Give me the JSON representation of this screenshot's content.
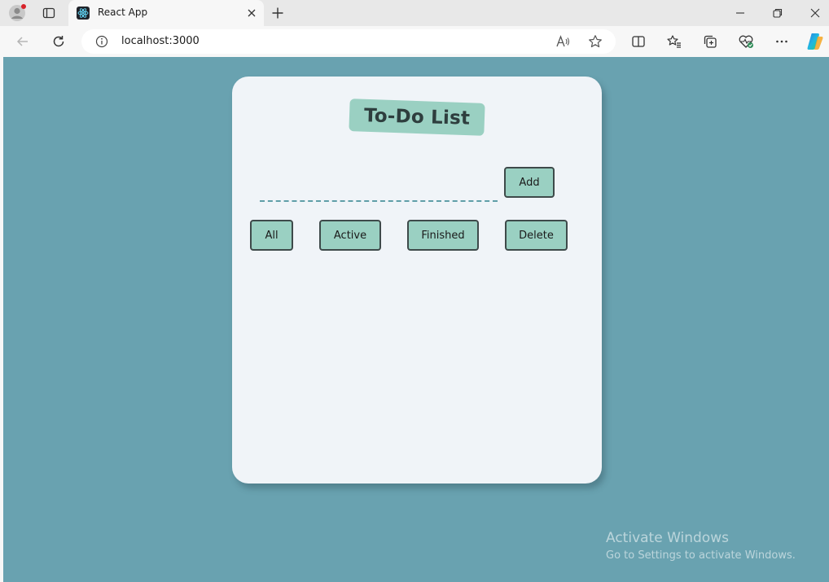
{
  "browser": {
    "tab": {
      "title": "React App"
    },
    "address": {
      "url": "localhost:3000"
    }
  },
  "app": {
    "title": "To-Do List",
    "input": {
      "value": "",
      "placeholder": ""
    },
    "buttons": {
      "add": "Add",
      "all": "All",
      "active": "Active",
      "finished": "Finished",
      "delete": "Delete"
    }
  },
  "watermark": {
    "title": "Activate Windows",
    "subtitle": "Go to Settings to activate Windows."
  },
  "colors": {
    "page_background": "#69a2b0",
    "card_background": "#f0f4f8",
    "accent": "#9ad0c2",
    "input_underline": "#5f9ea8"
  }
}
